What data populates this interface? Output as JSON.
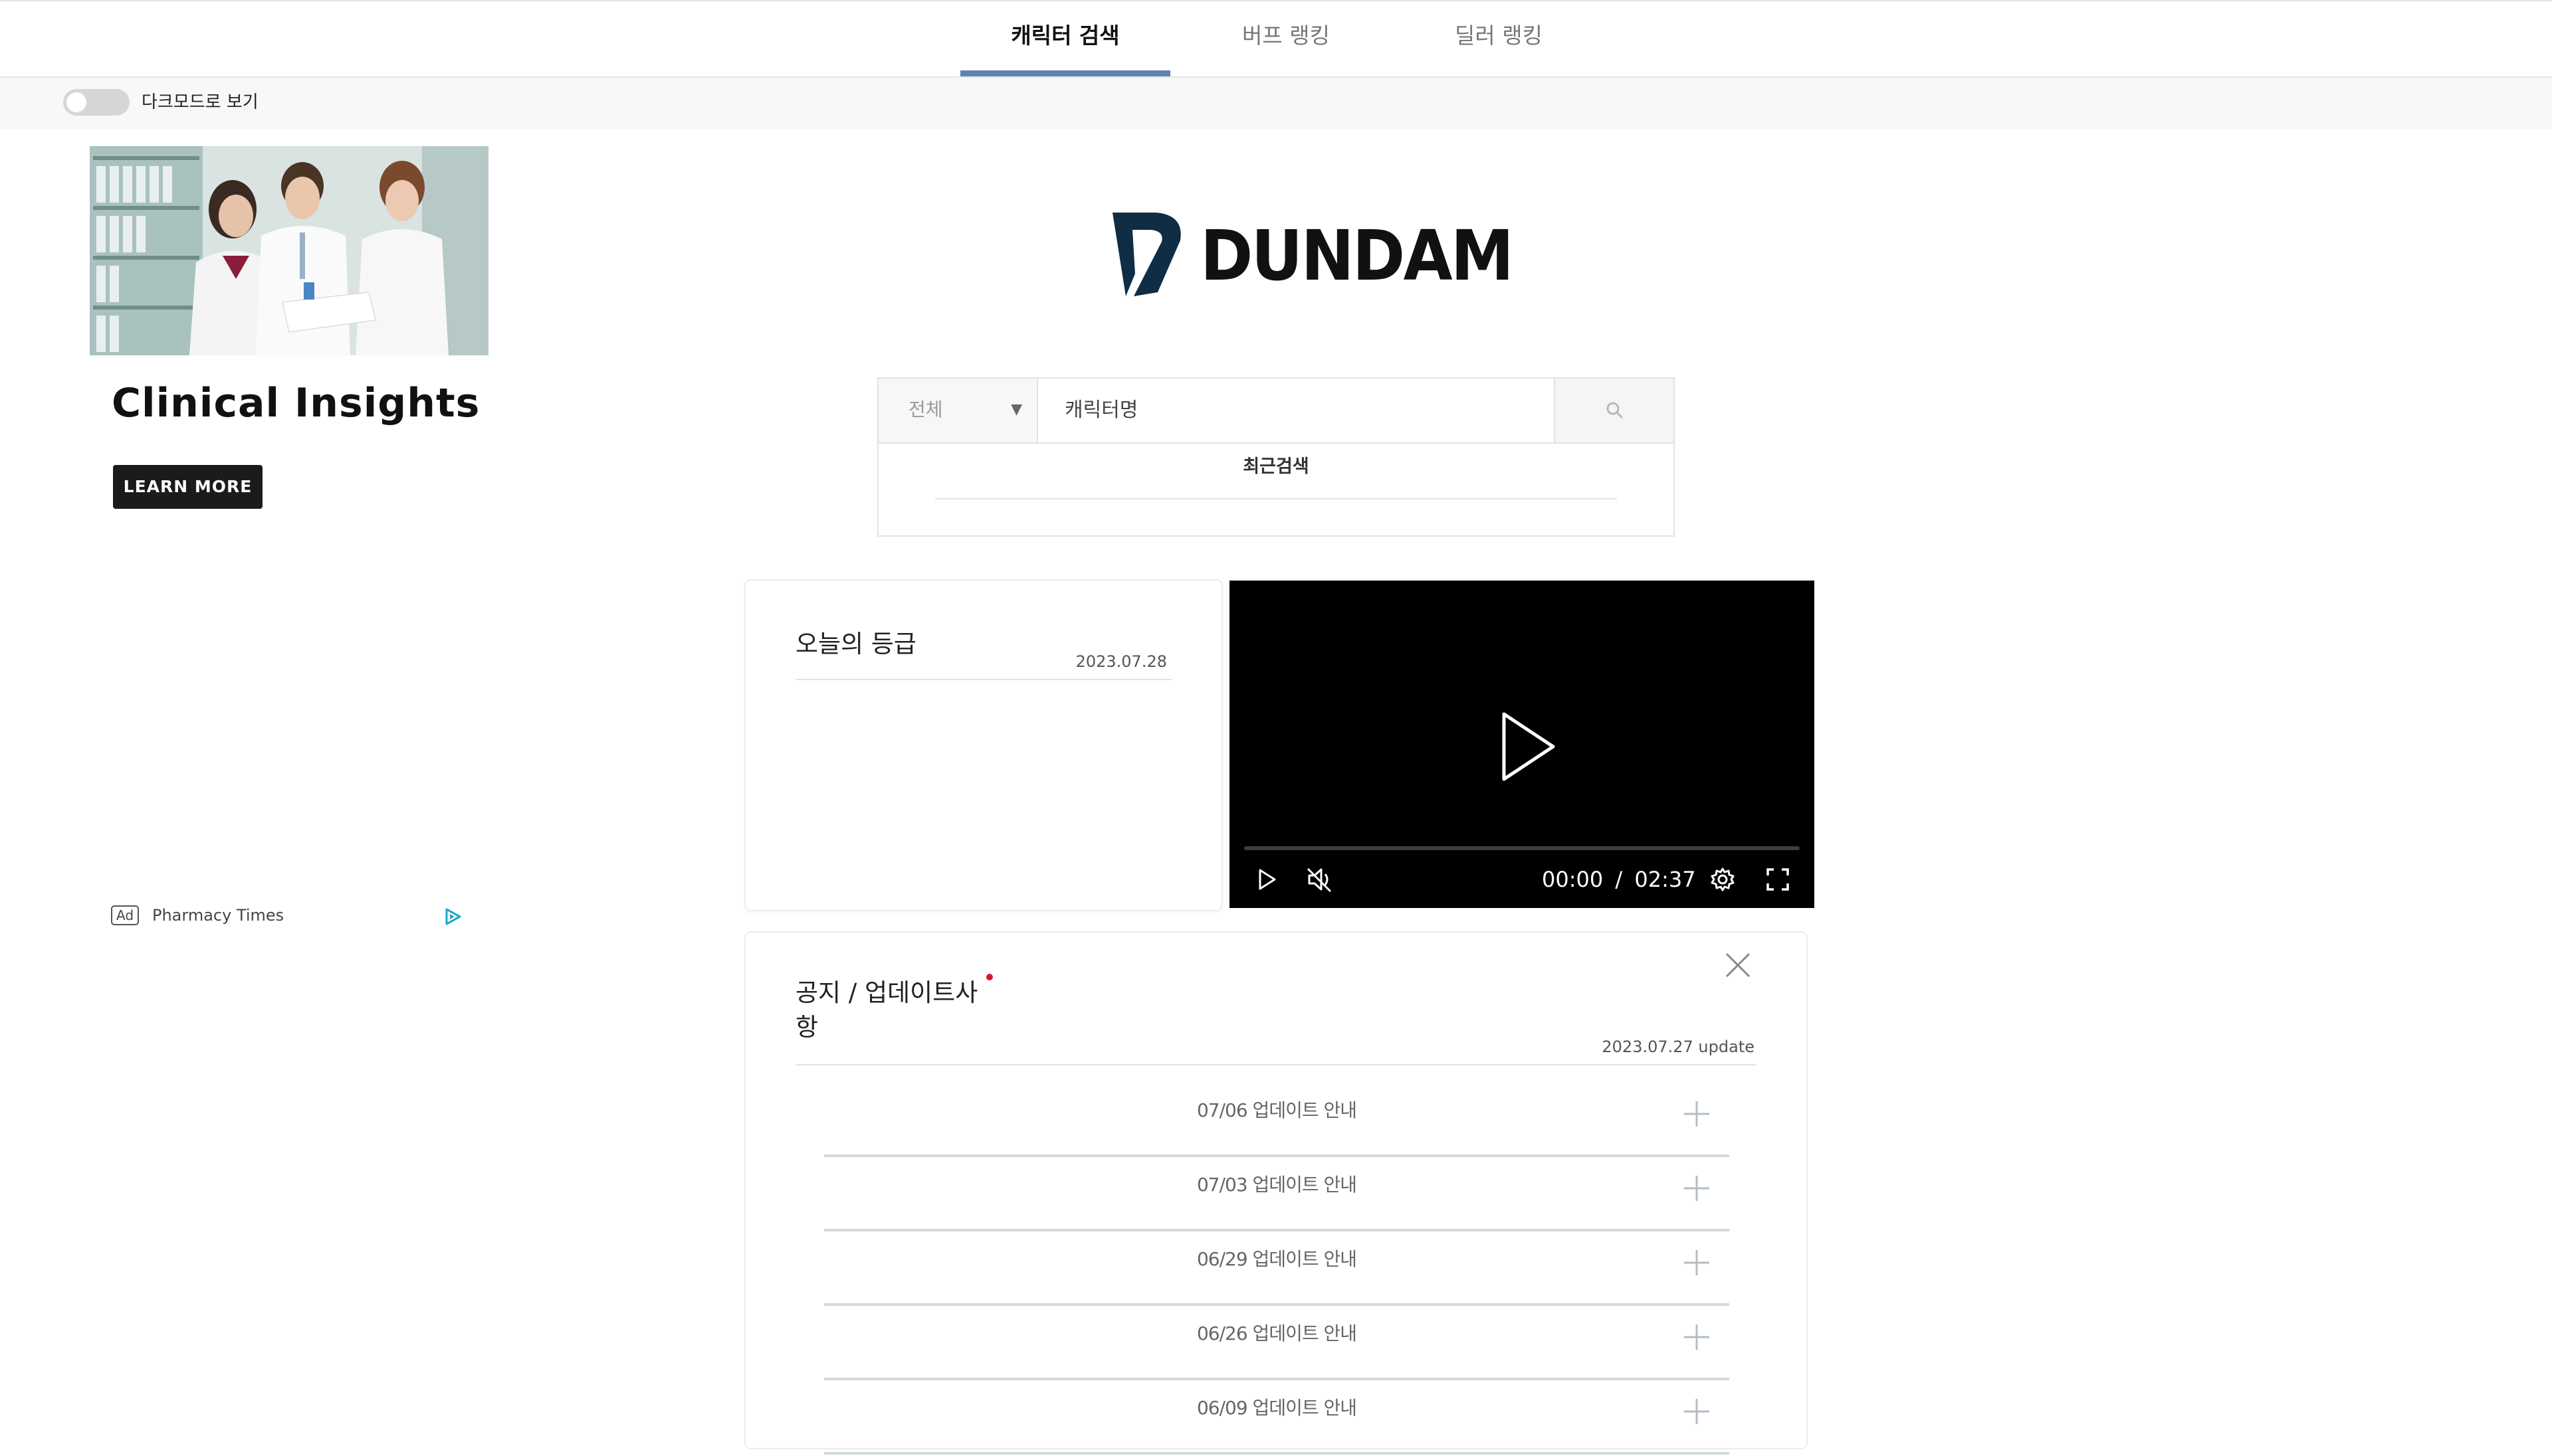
{
  "nav": {
    "tabs": [
      {
        "label": "캐릭터 검색",
        "active": true
      },
      {
        "label": "버프 랭킹",
        "active": false
      },
      {
        "label": "딜러 랭킹",
        "active": false
      }
    ],
    "accent_color": "#5f82b3"
  },
  "darkmode": {
    "label": "다크모드로 보기",
    "enabled": false
  },
  "ad": {
    "title": "Clinical Insights",
    "button_label": "LEARN MORE",
    "badge": "Ad",
    "sponsor": "Pharmacy Times",
    "icon": "adchoices-icon"
  },
  "logo": {
    "text": "DUNDAM",
    "color": "#0f2d45"
  },
  "search": {
    "category_selected": "전체",
    "input_placeholder": "캐릭터명",
    "input_value": "",
    "recent_label": "최근검색",
    "icon": "search-icon"
  },
  "grade": {
    "title": "오늘의 등급",
    "date": "2023.07.28"
  },
  "video": {
    "time_current": "00:00",
    "time_separator": "/",
    "time_total": "02:37",
    "progress": 0,
    "muted": true
  },
  "notice": {
    "title": "공지 / 업데이트사항",
    "date": "2023.07.27 update",
    "items": [
      {
        "label": "07/06 업데이트 안내"
      },
      {
        "label": "07/03 업데이트 안내"
      },
      {
        "label": "06/29 업데이트 안내"
      },
      {
        "label": "06/26 업데이트 안내"
      },
      {
        "label": "06/09 업데이트 안내"
      }
    ]
  }
}
